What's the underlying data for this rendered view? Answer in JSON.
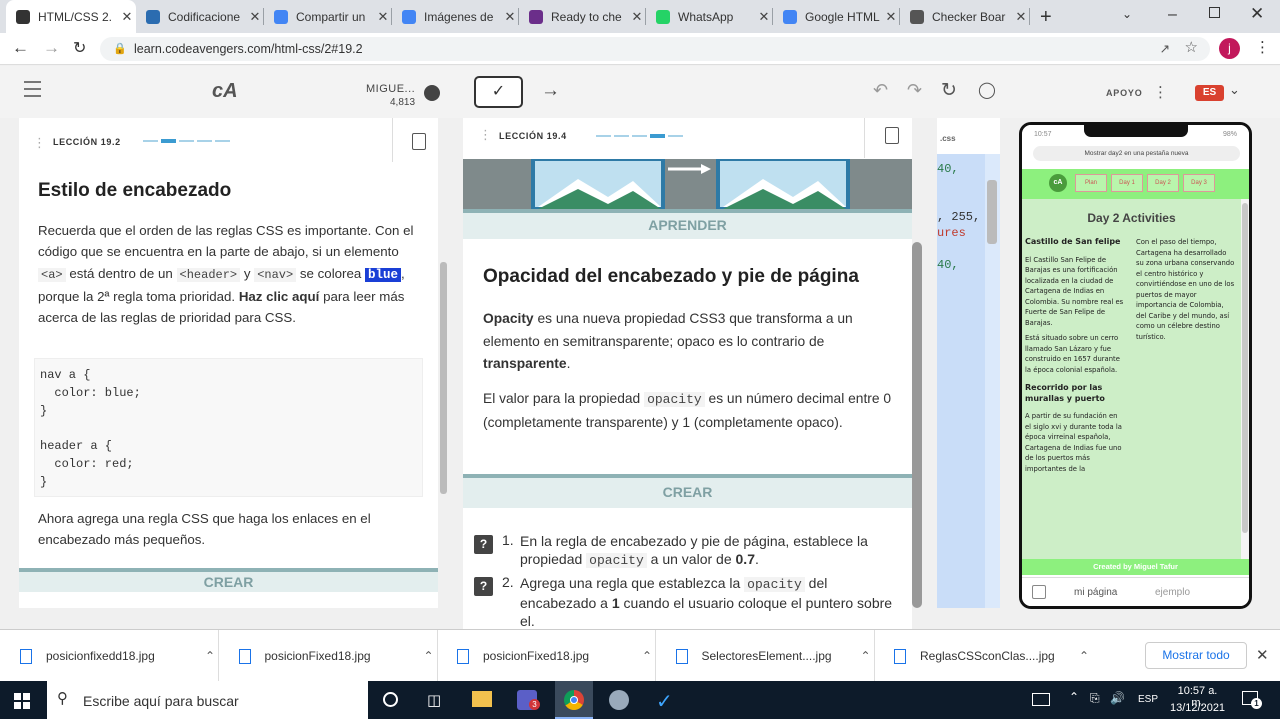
{
  "tabs": [
    {
      "title": "HTML/CSS 2.",
      "icon": "codeavengers-icon",
      "color": "#333333",
      "active": true
    },
    {
      "title": "Codificacione",
      "icon": "ws-icon",
      "color": "#2b6cb0"
    },
    {
      "title": "Compartir un",
      "icon": "google-icon",
      "color": "#4285f4"
    },
    {
      "title": "Imágenes de",
      "icon": "google-icon",
      "color": "#4285f4"
    },
    {
      "title": "Ready to che",
      "icon": "shield-icon",
      "color": "#6b2e8a"
    },
    {
      "title": "WhatsApp",
      "icon": "whatsapp-icon",
      "color": "#25d366"
    },
    {
      "title": "Google HTML",
      "icon": "google-icon",
      "color": "#4285f4"
    },
    {
      "title": "Checker Boar",
      "icon": "globe-icon",
      "color": "#555555"
    }
  ],
  "browser": {
    "url": "learn.codeavengers.com/html-css/2#19.2",
    "new_tab": "+",
    "profile_initial": "j"
  },
  "app_header": {
    "logo": "cA",
    "user_name": "MIGUE...",
    "user_points": "4,813",
    "support_label": "APOYO",
    "lang": "ES"
  },
  "left_panel": {
    "lesson": "LECCIÓN 19.2",
    "title": "Estilo de encabezado",
    "para1_a": "Recuerda que el orden de las reglas CSS es importante. Con el código que se encuentra en la parte de abajo, si un elemento",
    "tag_a": "<a>",
    "para1_b": "está dentro de un",
    "tag_header": "<header>",
    "para1_y": "y",
    "tag_nav": "<nav>",
    "para1_c": "se colorea",
    "blue_word": "blue",
    "para1_d": ", porque la 2ª regla toma prioridad.",
    "link_text": "Haz clic aquí",
    "para1_e": "para leer más acerca de las reglas de prioridad para CSS.",
    "code_lines": [
      "nav a {",
      "  color: blue;",
      "}",
      "",
      "header a {",
      "  color: red;",
      "}"
    ],
    "para2": "Ahora agrega una regla CSS que haga los enlaces en el encabezado más pequeños.",
    "crear": "CREAR"
  },
  "middle_panel": {
    "lesson": "LECCIÓN 19.4",
    "aprender": "APRENDER",
    "title": "Opacidad del encabezado y pie de página",
    "p1_bold": "Opacity",
    "p1_a": "es una nueva propiedad CSS3 que transforma a un elemento en semitransparente; opaco es lo contrario de",
    "p1_bold2": "transparente",
    "p1_end": ".",
    "p2_a": "El valor para la propiedad",
    "p2_code": "opacity",
    "p2_b": "es un número decimal entre 0 (completamente transparente) y 1 (completamente opaco).",
    "crear": "CREAR",
    "tasks": [
      {
        "num": "1.",
        "a": "En la regla de encabezado y pie de página, establece la propiedad",
        "code": "opacity",
        "b": "a un valor de",
        "bold": "0.7",
        "c": "."
      },
      {
        "num": "2.",
        "a": "Agrega una regla que establezca la",
        "code": "opacity",
        "b": "del encabezado a",
        "bold": "1",
        "c": "cuando el usuario coloque el puntero sobre el."
      }
    ]
  },
  "editor": {
    "tab_label": ".css",
    "line1": "40,",
    "line2": ", 255,",
    "line3": "ures",
    "line4": "40,"
  },
  "phone": {
    "time": "10:57",
    "battery": "98%",
    "address": "Mostrar day2 en una pestaña nueva",
    "nav": [
      "Plan",
      "Day 1",
      "Day 2",
      "Day 3"
    ],
    "heading": "Day 2 Activities",
    "col1_title1": "Castillo de San felipe",
    "col1_p1": "El Castillo San Felipe de Barajas es una fortificación localizada en la ciudad de Cartagena de Indias en Colombia. Su nombre real es Fuerte de San Felipe de Barajas.",
    "col1_p2": "Está situado sobre un cerro llamado San Lázaro y fue construido en 1657 durante la época colonial española.",
    "col1_title2": "Recorrido por las murallas y puerto",
    "col1_p3": "A partir de su fundación en el siglo xvi y durante toda la época virreinal española, Cartagena de Indias fue uno de los puertos más importantes de la",
    "col2_p": "Con el paso del tiempo, Cartagena ha desarrollado su zona urbana conservando el centro histórico y convirtiéndose en uno de los puertos de mayor importancia de Colombia, del Caribe y del mundo, así como un célebre destino turístico.",
    "footer": "Created by Miguel Tafur",
    "tab_page": "mi página",
    "tab_example": "ejemplo"
  },
  "downloads": {
    "items": [
      "posicionfixedd18.jpg",
      "posicionFixed18.jpg",
      "posicionFixed18.jpg",
      "SelectoresElement....jpg",
      "ReglasCSSconClas....jpg"
    ],
    "show_all": "Mostrar todo"
  },
  "taskbar": {
    "search_placeholder": "Escribe aquí para buscar",
    "lang": "ESP",
    "time": "10:57 a. m.",
    "date": "13/12/2021",
    "teams_badge": "3",
    "notif_count": "1"
  }
}
